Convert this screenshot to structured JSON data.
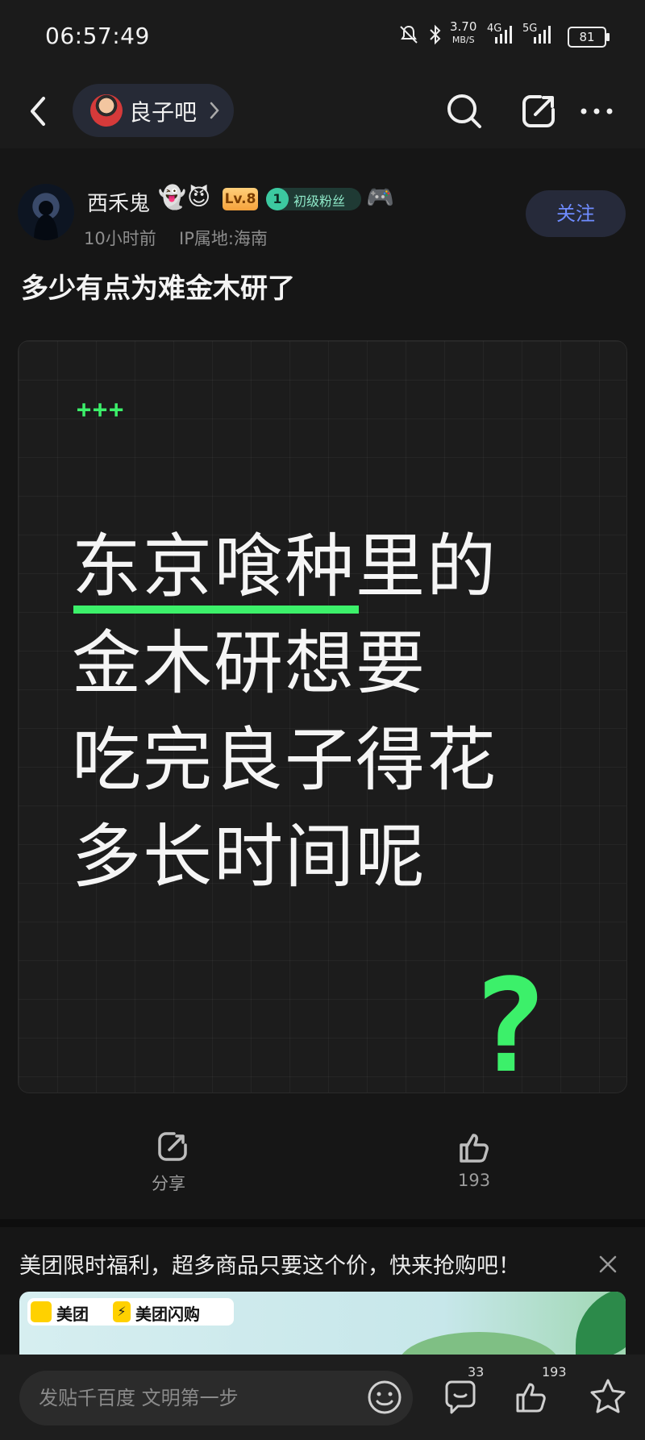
{
  "status_bar": {
    "time": "06:57:49",
    "speed_value": "3.70",
    "speed_unit": "MB/S",
    "net1": "4G",
    "net2": "5G",
    "battery": "81"
  },
  "header": {
    "forum_name": "良子吧",
    "icons": [
      "back-icon",
      "search-icon",
      "share-icon",
      "more-icon"
    ]
  },
  "post": {
    "author": "西禾鬼",
    "author_emojis": [
      "👻",
      "😈"
    ],
    "level": "Lv.8",
    "fan_level": "1",
    "fan_title": "初级粉丝",
    "extra_emoji": "🎮",
    "time": "10小时前",
    "ip": "IP属地:海南",
    "follow_label": "关注",
    "title": "多少有点为难金木研了",
    "image": {
      "plus": "+++",
      "lines": [
        "东京喰种里的",
        "金木研想要",
        "吃完良子得花",
        "多长时间呢"
      ],
      "question": "?"
    }
  },
  "actions": {
    "share_label": "分享",
    "like_count": "193"
  },
  "ad": {
    "text": "美团限时福利，超多商品只要这个价，快来抢购吧！",
    "brand1": "美团",
    "brand2": "美团闪购"
  },
  "bottom_bar": {
    "placeholder": "发贴千百度 文明第一步",
    "comment_count": "33",
    "like_count": "193"
  }
}
